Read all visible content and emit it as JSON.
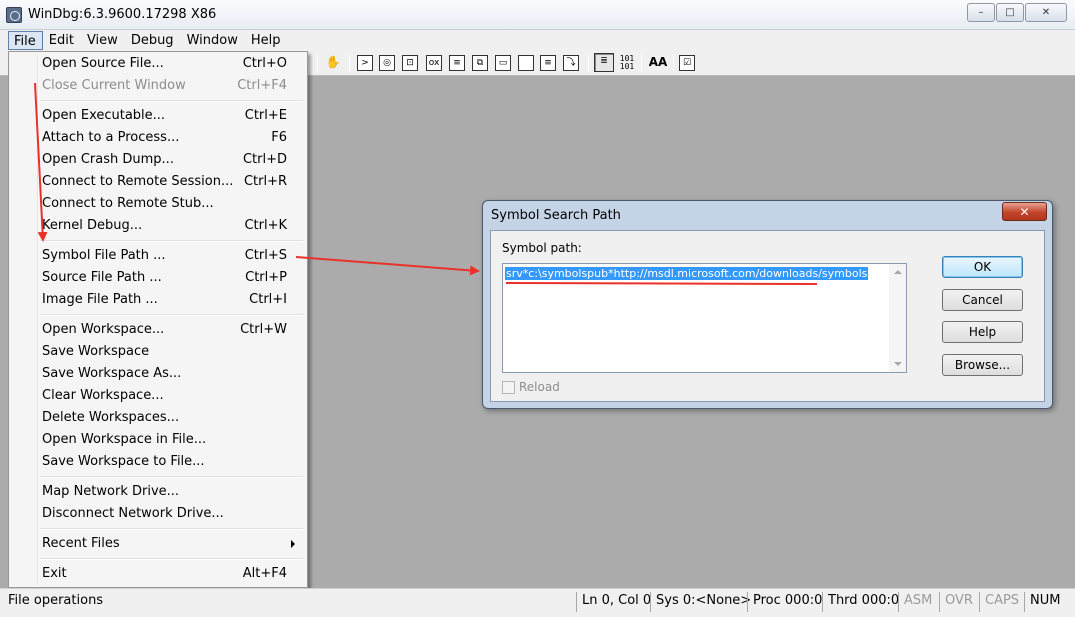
{
  "window": {
    "title": "WinDbg:6.3.9600.17298 X86",
    "controls": {
      "minimize": "–",
      "maximize": "□",
      "close": "✕"
    }
  },
  "menubar": {
    "items": [
      "File",
      "Edit",
      "View",
      "Debug",
      "Window",
      "Help"
    ],
    "active": "File"
  },
  "toolbar": {
    "icons": [
      "hand-icon",
      "command-icon",
      "watch-icon",
      "locals-icon",
      "registers-icon",
      "memory-icon",
      "callstack-icon",
      "disassembly-icon",
      "scratchpad-icon",
      "processes-threads-icon",
      "source-mode-icon",
      "hex-mode-icon",
      "font-icon",
      "options-icon"
    ],
    "hex_glyph": "101\n101",
    "font_glyph": "AA"
  },
  "file_menu": {
    "items": [
      {
        "label": "Open Source File...",
        "accel": "Ctrl+O",
        "disabled": false
      },
      {
        "label": "Close Current Window",
        "accel": "Ctrl+F4",
        "disabled": true
      },
      {
        "label": "Open Executable...",
        "accel": "Ctrl+E",
        "disabled": false
      },
      {
        "label": "Attach to a Process...",
        "accel": "F6",
        "disabled": false
      },
      {
        "label": "Open Crash Dump...",
        "accel": "Ctrl+D",
        "disabled": false
      },
      {
        "label": "Connect to Remote Session...",
        "accel": "Ctrl+R",
        "disabled": false
      },
      {
        "label": "Connect to Remote Stub...",
        "accel": "",
        "disabled": false
      },
      {
        "label": "Kernel Debug...",
        "accel": "Ctrl+K",
        "disabled": false
      },
      {
        "label": "Symbol File Path ...",
        "accel": "Ctrl+S",
        "disabled": false
      },
      {
        "label": "Source File Path ...",
        "accel": "Ctrl+P",
        "disabled": false
      },
      {
        "label": "Image File Path ...",
        "accel": "Ctrl+I",
        "disabled": false
      },
      {
        "label": "Open Workspace...",
        "accel": "Ctrl+W",
        "disabled": false
      },
      {
        "label": "Save Workspace",
        "accel": "",
        "disabled": false
      },
      {
        "label": "Save Workspace As...",
        "accel": "",
        "disabled": false
      },
      {
        "label": "Clear Workspace...",
        "accel": "",
        "disabled": false
      },
      {
        "label": "Delete Workspaces...",
        "accel": "",
        "disabled": false
      },
      {
        "label": "Open Workspace in File...",
        "accel": "",
        "disabled": false
      },
      {
        "label": "Save Workspace to File...",
        "accel": "",
        "disabled": false
      },
      {
        "label": "Map Network Drive...",
        "accel": "",
        "disabled": false
      },
      {
        "label": "Disconnect Network Drive...",
        "accel": "",
        "disabled": false
      },
      {
        "label": "Recent Files",
        "accel": "",
        "disabled": false
      },
      {
        "label": "Exit",
        "accel": "Alt+F4",
        "disabled": false
      }
    ]
  },
  "dialog": {
    "title": "Symbol Search Path",
    "close": "✕",
    "symbol_path_label": "Symbol path:",
    "symbol_path_value": "srv*c:\\symbolspub*http://msdl.microsoft.com/downloads/symbols",
    "reload_label": "Reload",
    "buttons": {
      "ok": "OK",
      "cancel": "Cancel",
      "help": "Help",
      "browse": "Browse..."
    }
  },
  "statusbar": {
    "message": "File operations",
    "line_col": "Ln 0, Col 0",
    "sys": "Sys 0:<None>",
    "proc": "Proc 000:0",
    "thrd": "Thrd 000:0",
    "asm": "ASM",
    "ovr": "OVR",
    "caps": "CAPS",
    "num": "NUM"
  },
  "colors": {
    "workspace_bg": "#ababab",
    "selection": "#3399ff",
    "annotation_red": "#e8322a"
  }
}
